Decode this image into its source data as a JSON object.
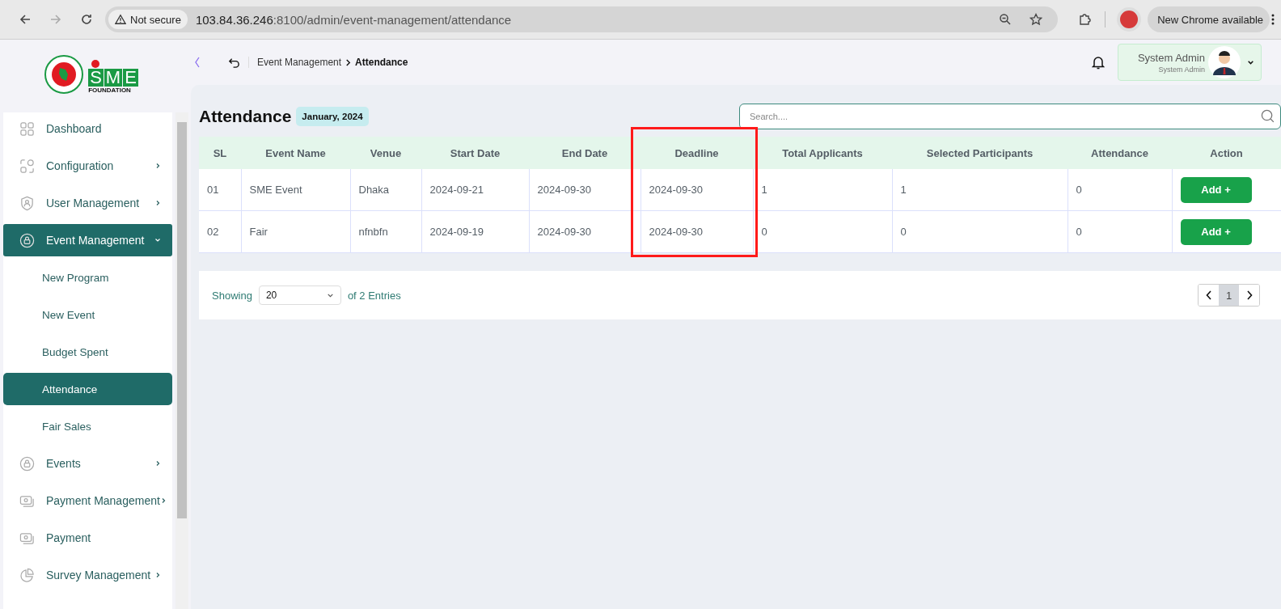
{
  "browser": {
    "security": "Not secure",
    "url_host": "103.84.36.246",
    "url_path": ":8100/admin/event-management/attendance",
    "update_button": "New Chrome available"
  },
  "logo": {
    "letters": [
      "S",
      "M",
      "E"
    ],
    "subtitle": "FOUNDATION"
  },
  "sidebar": {
    "items": [
      {
        "label": "Dashboard",
        "kind": "link",
        "selected": false
      },
      {
        "label": "Configuration",
        "kind": "group",
        "expanded": false,
        "selected": false
      },
      {
        "label": "User Management",
        "kind": "group",
        "expanded": false,
        "selected": false
      },
      {
        "label": "Event Management",
        "kind": "group",
        "expanded": true,
        "selected": true,
        "children": [
          {
            "label": "New Program",
            "selected": false
          },
          {
            "label": "New Event",
            "selected": false
          },
          {
            "label": "Budget Spent",
            "selected": false
          },
          {
            "label": "Attendance",
            "selected": true
          },
          {
            "label": "Fair Sales",
            "selected": false
          }
        ]
      },
      {
        "label": "Events",
        "kind": "group",
        "expanded": false,
        "selected": false
      },
      {
        "label": "Payment Management",
        "kind": "group",
        "expanded": false,
        "selected": false
      },
      {
        "label": "Payment",
        "kind": "link",
        "selected": false
      },
      {
        "label": "Survey Management",
        "kind": "group",
        "expanded": false,
        "selected": false
      }
    ]
  },
  "header": {
    "breadcrumb": [
      "Event Management",
      "Attendance"
    ],
    "user": {
      "name": "System Admin",
      "role": "System Admin"
    }
  },
  "page": {
    "title": "Attendance",
    "period_badge": "January, 2024",
    "search": {
      "placeholder": "Search...."
    }
  },
  "table": {
    "columns": [
      {
        "label": "SL",
        "highlighted": false
      },
      {
        "label": "Event Name",
        "highlighted": false
      },
      {
        "label": "Venue",
        "highlighted": false
      },
      {
        "label": "Start Date",
        "highlighted": false
      },
      {
        "label": "End Date",
        "highlighted": false
      },
      {
        "label": "Deadline",
        "highlighted": true
      },
      {
        "label": "Total Applicants",
        "highlighted": false
      },
      {
        "label": "Selected Participants",
        "highlighted": false
      },
      {
        "label": "Attendance",
        "highlighted": false
      },
      {
        "label": "Action",
        "highlighted": false
      }
    ],
    "rows": [
      {
        "cells": [
          "01",
          "SME Event",
          "Dhaka",
          "2024-09-21",
          "2024-09-30",
          "2024-09-30",
          "1",
          "1",
          "0"
        ],
        "action": "Add +"
      },
      {
        "cells": [
          "02",
          "Fair",
          "nfnbfn",
          "2024-09-19",
          "2024-09-30",
          "2024-09-30",
          "0",
          "0",
          "0"
        ],
        "action": "Add +"
      }
    ]
  },
  "footer": {
    "showing_label": "Showing",
    "page_size": "20",
    "entries_label": "of 2 Entries",
    "pages": [
      {
        "label": "1",
        "selected": true
      }
    ]
  }
}
